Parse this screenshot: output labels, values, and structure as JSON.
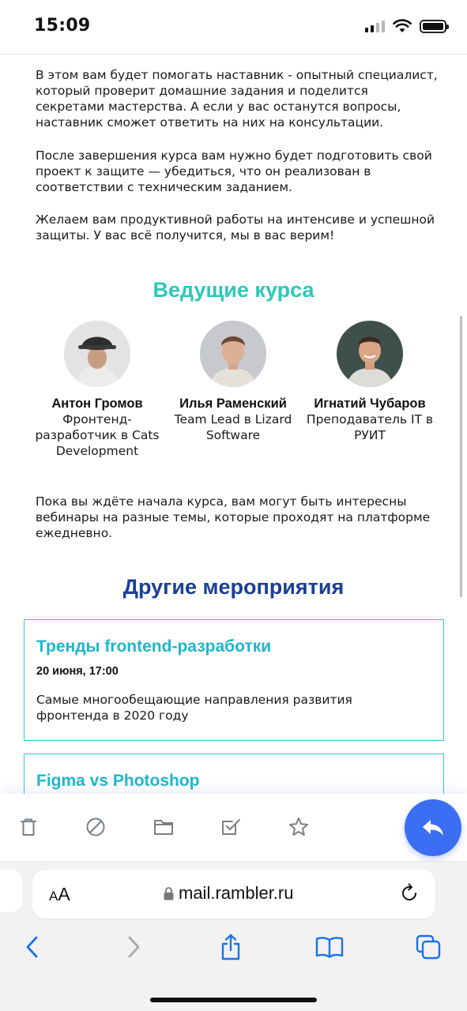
{
  "status_bar": {
    "time": "15:09",
    "icons": [
      "signal-icon",
      "wifi-icon",
      "battery-icon"
    ]
  },
  "email": {
    "paragraph_1": "В этом вам будет помогать наставник - опытный специалист, который проверит домашние задания и поделится секретами мастерства. А если у вас останутся вопросы, наставник сможет ответить на них на консультации.",
    "paragraph_2": "После завершения курса вам нужно будет подготовить свой проект к защите — убедиться, что он реализован в соответствии с техническим заданием.",
    "paragraph_3": "Желаем вам продуктивной работы на интенсиве и успешной защиты. У вас всё получится, мы в вас верим!",
    "mentors_title": "Ведущие курса",
    "mentors": [
      {
        "name": "Антон Громов",
        "role": "Фронтенд-разработчик в Cats Development"
      },
      {
        "name": "Илья Раменский",
        "role": "Team Lead в Lizard Software"
      },
      {
        "name": "Игнатий Чубаров",
        "role": "Преподаватель IT в РУИТ"
      }
    ],
    "paragraph_4": "Пока вы ждёте начала курса, вам могут быть интересны вебинары на разные темы, которые проходят на платформе ежедневно.",
    "events_title": "Другие мероприятия",
    "events": [
      {
        "title": "Тренды frontend-разработки",
        "date": "20 июня, 17:00",
        "description": "Самые многообещающие направления развития фронтенда в 2020 году"
      },
      {
        "title": "Figma vs Photoshop"
      }
    ]
  },
  "mail_toolbar": {
    "buttons": [
      "trash-icon",
      "block-icon",
      "folder-icon",
      "mark-done-icon",
      "star-icon"
    ],
    "reply_button": "reply-icon"
  },
  "browser": {
    "text_size_small": "A",
    "text_size_large": "A",
    "url": "mail.rambler.ru",
    "nav_buttons": [
      "back-icon",
      "forward-icon",
      "share-icon",
      "bookmarks-icon",
      "tabs-icon"
    ]
  },
  "colors": {
    "accent_teal": "#2cc8b8",
    "accent_navy": "#1b3f95",
    "card_border": "#37c3d3",
    "event_title": "#1fb6cb",
    "reply_button": "#3b6ef2",
    "ios_blue": "#1a73e8"
  }
}
